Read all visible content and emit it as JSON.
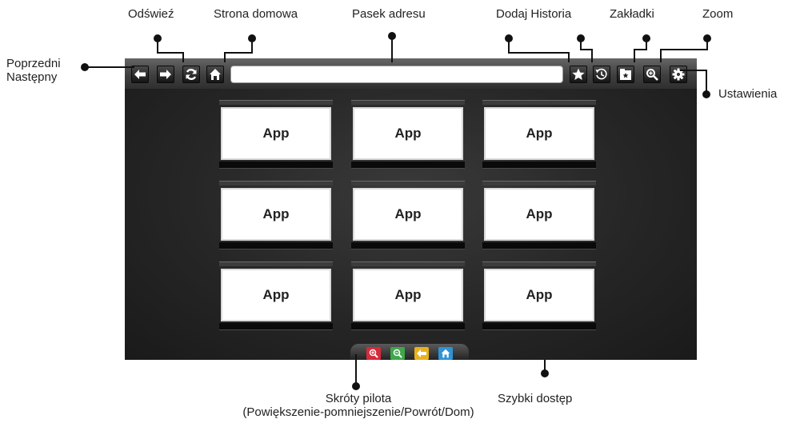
{
  "callouts": {
    "refresh": "Odświeź",
    "home_page": "Strona domowa",
    "address_bar": "Pasek adresu",
    "add_history": "Dodaj Historia",
    "bookmarks": "Zakładki",
    "zoom": "Zoom",
    "prev_line1": "Poprzedni",
    "prev_line2": "Następny",
    "settings": "Ustawienia",
    "remote_line1": "Skróty pilota",
    "remote_line2": "(Powiększenie-pomniejszenie/Powrót/Dom)",
    "quick_access": "Szybki dostęp"
  },
  "tiles": [
    {
      "label": "App"
    },
    {
      "label": "App"
    },
    {
      "label": "App"
    },
    {
      "label": "App"
    },
    {
      "label": "App"
    },
    {
      "label": "App"
    },
    {
      "label": "App"
    },
    {
      "label": "App"
    },
    {
      "label": "App"
    }
  ],
  "address_bar": {
    "value": ""
  },
  "toolbar_icons": [
    "back-arrow-icon",
    "forward-arrow-icon",
    "refresh-icon",
    "home-icon",
    "star-icon",
    "history-icon",
    "bookmarks-icon",
    "zoom-icon",
    "gear-icon"
  ],
  "quick_access_icons": [
    "zoom-in-icon",
    "zoom-out-icon",
    "back-icon",
    "home-icon"
  ],
  "colors": {
    "callout_line": "#111111",
    "zoom_in": "#d62b3b",
    "zoom_out": "#3fa64a",
    "back": "#e8b21e",
    "home": "#2f93d6"
  }
}
